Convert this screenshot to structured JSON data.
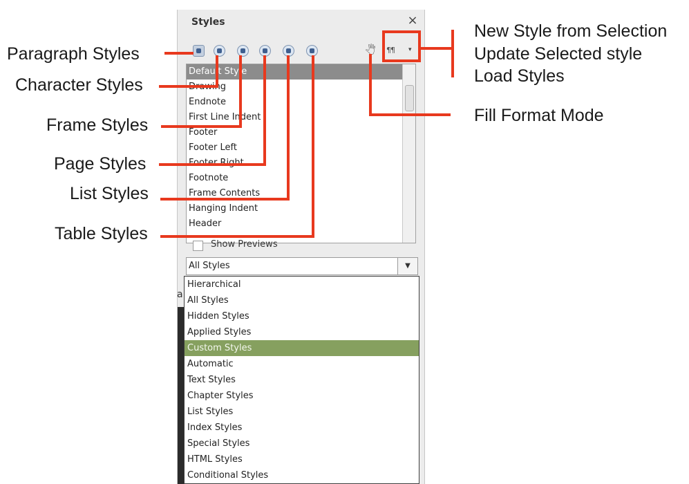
{
  "panel": {
    "title": "Styles",
    "close_glyph": "×",
    "toolbar": {
      "icons": [
        "paragraph-styles-icon",
        "character-styles-icon",
        "frame-styles-icon",
        "page-styles-icon",
        "list-styles-icon",
        "table-styles-icon"
      ],
      "fill_format_glyph": "🖑",
      "new_style_glyph": "¶¶",
      "dropdown_glyph": "▾"
    },
    "style_list": [
      "Default Style",
      "Drawing",
      "Endnote",
      "First Line Indent",
      "Footer",
      "Footer Left",
      "Footer Right",
      "Footnote",
      "Frame Contents",
      "Hanging Indent",
      "Header"
    ],
    "selected_style": "Default Style",
    "show_previews_label": "Show Previews",
    "filter_value": "All Styles",
    "filter_arrow": "▼",
    "filter_options": [
      "Hierarchical",
      "All Styles",
      "Hidden Styles",
      "Applied Styles",
      "Custom Styles",
      "Automatic",
      "Text Styles",
      "Chapter Styles",
      "List Styles",
      "Index Styles",
      "Special Styles",
      "HTML Styles",
      "Conditional Styles"
    ],
    "highlighted_option": "Custom Styles",
    "stub_text": "a"
  },
  "callouts": {
    "paragraph": "Paragraph Styles",
    "character": "Character Styles",
    "frame": "Frame Styles",
    "page": "Page Styles",
    "list": "List Styles",
    "table": "Table Styles",
    "new_style": "New Style from Selection",
    "update_style": "Update Selected style",
    "load_styles": "Load Styles",
    "fill_format": "Fill Format Mode"
  },
  "colors": {
    "callout_line": "#e8391e",
    "highlight": "#86a05f",
    "selected_row": "#8c8c8c"
  }
}
